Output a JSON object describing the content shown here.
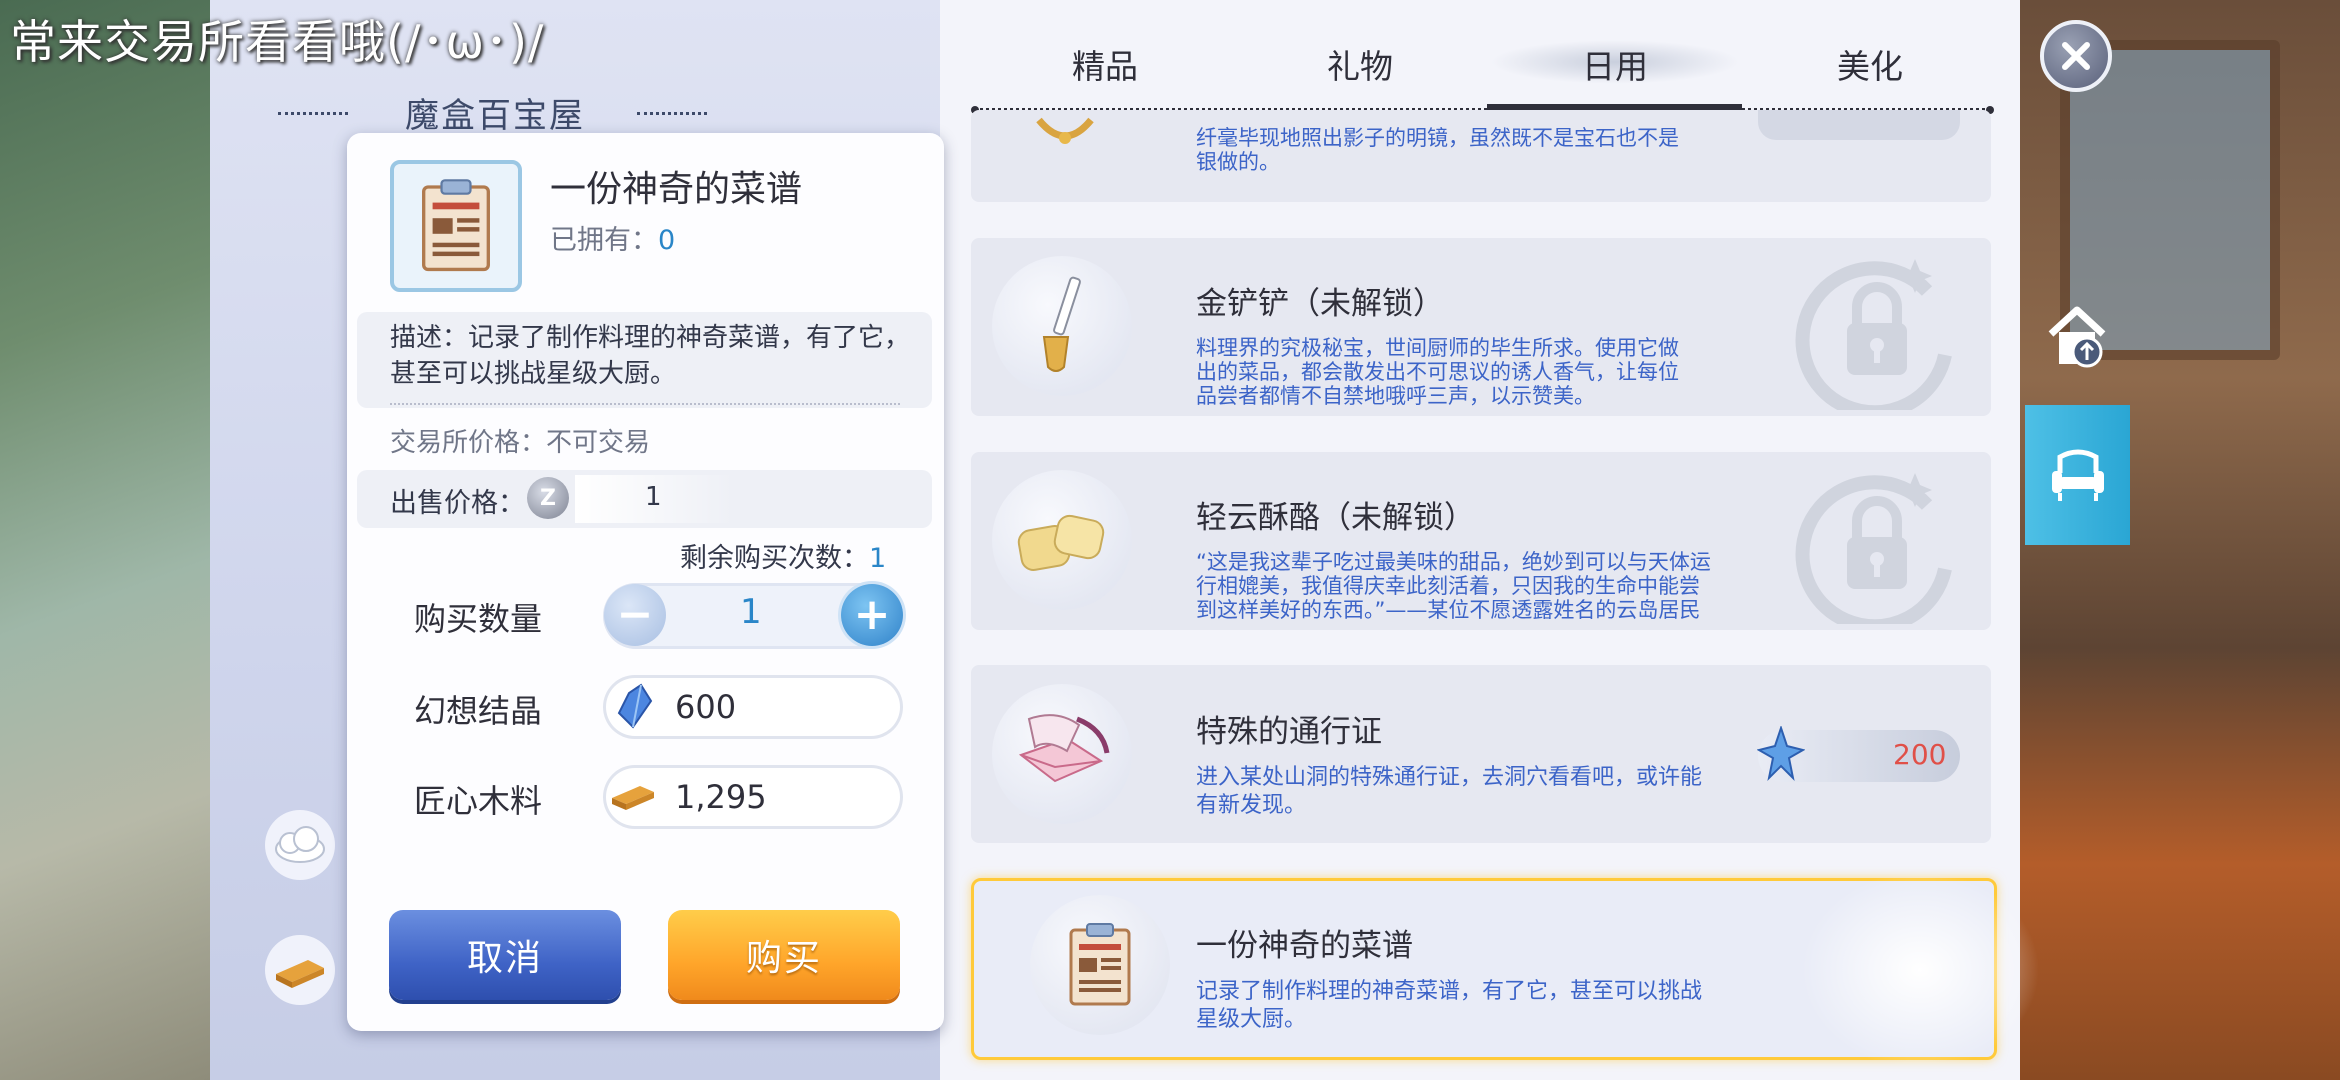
{
  "caption": "常来交易所看看哦(/･ω･)/",
  "shop_title": "魔盒百宝屋",
  "dialog": {
    "item_name": "一份神奇的菜谱",
    "owned_label": "已拥有：",
    "owned_count": "0",
    "description": "描述：记录了制作料理的神奇菜谱，有了它，甚至可以挑战星级大厨。",
    "trade_price": "交易所价格：不可交易",
    "sell_label": "出售价格：",
    "sell_coin": "Z",
    "sell_value": "1",
    "remain_label": "剩余购买次数：",
    "remain_count": "1",
    "quantity_label": "购买数量",
    "quantity": "1",
    "costs": [
      {
        "label": "幻想结晶",
        "value": "600",
        "icon": "crystal-icon"
      },
      {
        "label": "匠心木料",
        "value": "1,295",
        "icon": "wood-plank-icon"
      }
    ],
    "cancel_label": "取消",
    "buy_label": "购买"
  },
  "tabs": [
    {
      "label": "精品",
      "active": false
    },
    {
      "label": "礼物",
      "active": false
    },
    {
      "label": "日用",
      "active": true
    },
    {
      "label": "美化",
      "active": false
    }
  ],
  "items": [
    {
      "title": "",
      "desc": "纤毫毕现地照出影子的明镜，虽然既不是宝石也不是银做的。",
      "icon": "mirror-icon"
    },
    {
      "title": "金铲铲（未解锁）",
      "desc": "料理界的究极秘宝，世间厨师的毕生所求。使用它做出的菜品，都会散发出不可思议的诱人香气，让每位品尝者都情不自禁地哦呼三声，以示赞美。",
      "icon": "golden-shovel-icon",
      "locked": true
    },
    {
      "title": "轻云酥酪（未解锁）",
      "desc": "“这是我这辈子吃过最美味的甜品，绝妙到可以与天体运行相媲美，我值得庆幸此刻活着，只因我的生命中能尝到这样美好的东西。”——某位不愿透露姓名的云岛居民",
      "icon": "cloud-pastry-icon",
      "locked": true
    },
    {
      "title": "特殊的通行证",
      "desc": "进入某处山洞的特殊通行证，去洞穴看看吧，或许能有新发现。",
      "icon": "pass-letter-icon",
      "price": "200"
    },
    {
      "title": "一份神奇的菜谱",
      "desc": "记录了制作料理的神奇菜谱，有了它，甚至可以挑战星级大厨。",
      "icon": "recipe-icon",
      "selected": true
    }
  ],
  "colors": {
    "accent_blue": "#2a86c8",
    "desc_blue": "#3c64c8",
    "price_red": "#e05048",
    "selected_border": "#ffca3a",
    "cancel_btn": "#3f63c6",
    "buy_btn": "#ffa52a"
  }
}
